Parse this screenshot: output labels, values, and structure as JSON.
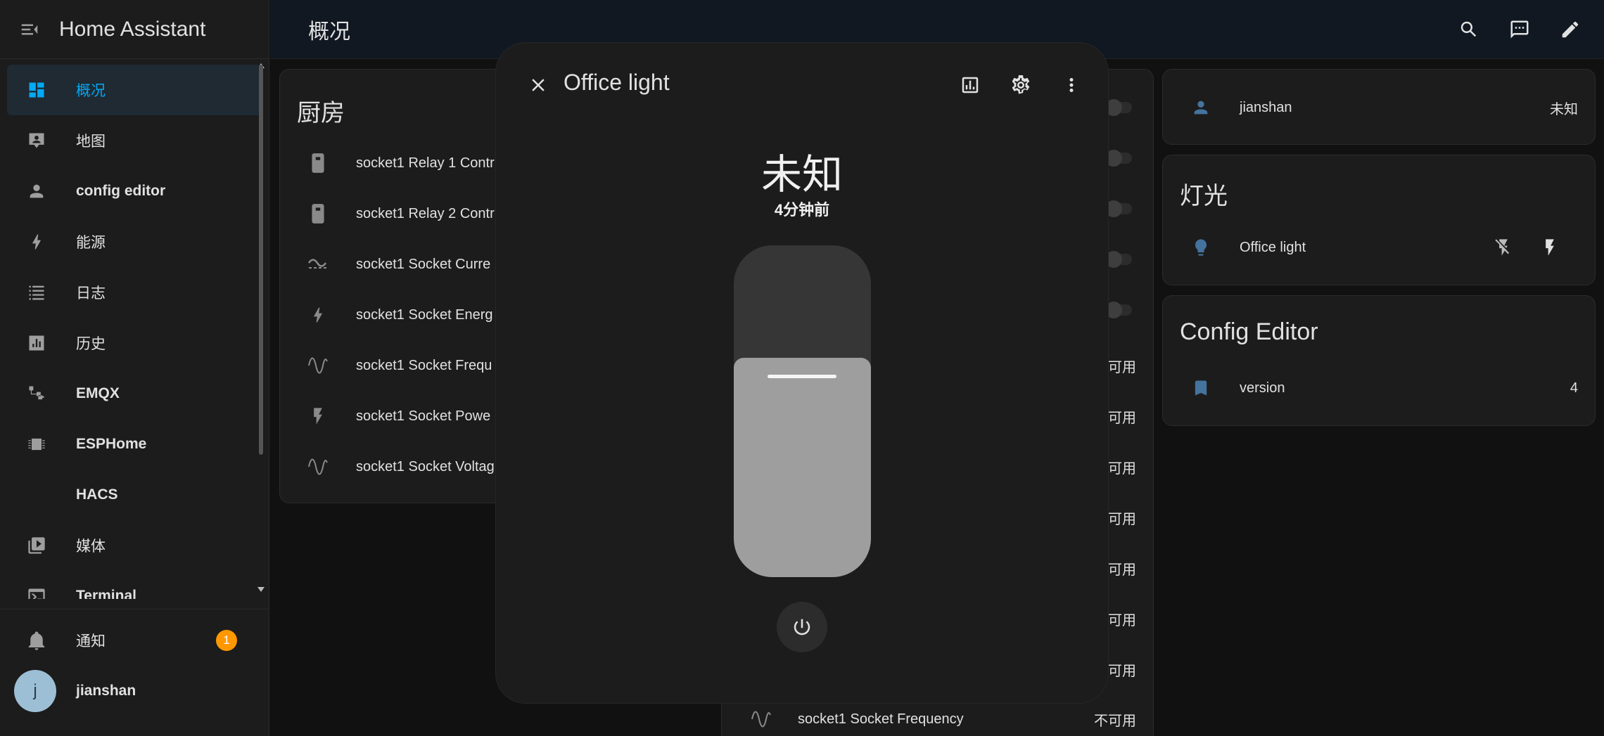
{
  "sidebar": {
    "title": "Home Assistant",
    "items": [
      {
        "label": "概况",
        "icon": "dashboard-icon",
        "active": true
      },
      {
        "label": "地图",
        "icon": "map-account-icon"
      },
      {
        "label": "config editor",
        "icon": "account-icon"
      },
      {
        "label": "能源",
        "icon": "lightning-icon"
      },
      {
        "label": "日志",
        "icon": "list-icon"
      },
      {
        "label": "历史",
        "icon": "chart-box-icon"
      },
      {
        "label": "EMQX",
        "icon": "connection-icon"
      },
      {
        "label": "ESPHome",
        "icon": "chip-icon"
      },
      {
        "label": "HACS",
        "icon": "none"
      },
      {
        "label": "媒体",
        "icon": "play-box-icon"
      },
      {
        "label": "Terminal",
        "icon": "console-icon"
      }
    ],
    "notifications": {
      "label": "通知",
      "badge": "1"
    },
    "user": {
      "label": "jianshan",
      "initial": "j"
    }
  },
  "topbar": {
    "title": "概况"
  },
  "kitchen_card": {
    "title": "厨房",
    "rows": [
      {
        "label": "socket1 Relay 1 Contr",
        "icon": "socket-icon"
      },
      {
        "label": "socket1 Relay 2 Contr",
        "icon": "socket-icon"
      },
      {
        "label": "socket1 Socket Curre",
        "icon": "current-ac-icon"
      },
      {
        "label": "socket1 Socket Energ",
        "icon": "lightning-icon"
      },
      {
        "label": "socket1 Socket Frequ",
        "icon": "sine-wave-icon"
      },
      {
        "label": "socket1 Socket Powe",
        "icon": "flash-icon"
      },
      {
        "label": "socket1 Socket Voltag",
        "icon": "sine-wave-icon"
      }
    ]
  },
  "middle_card": {
    "values": [
      "可用",
      "可用",
      "可用",
      "可用",
      "可用",
      "可用",
      "可用"
    ],
    "bottom_row": {
      "label": "socket1 Socket Frequency",
      "value": "不可用"
    }
  },
  "person_card": {
    "name": "jianshan",
    "state": "未知"
  },
  "lights_card": {
    "title": "灯光",
    "entity": "Office light"
  },
  "config_card": {
    "title": "Config Editor",
    "entity": "version",
    "value": "4"
  },
  "dialog": {
    "title": "Office light",
    "state": "未知",
    "last_changed": "4分钟前",
    "brightness_fraction": 0.66
  }
}
